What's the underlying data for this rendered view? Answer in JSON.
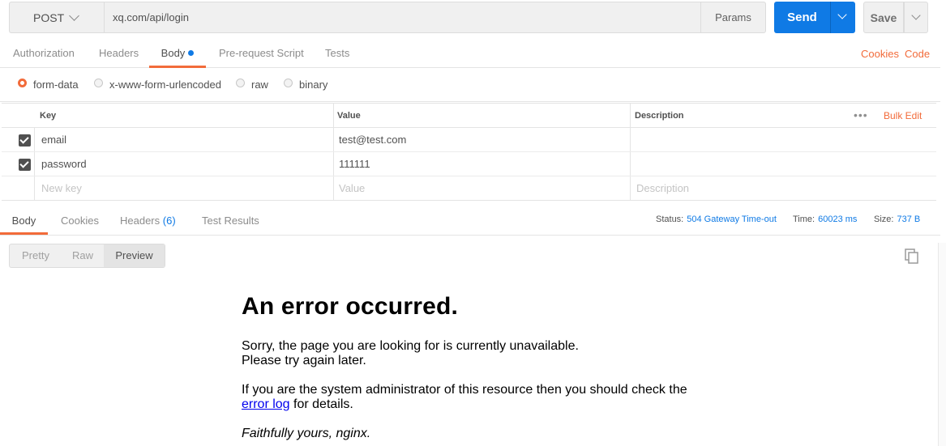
{
  "request": {
    "method": "POST",
    "url": "xq.com/api/login",
    "params_label": "Params",
    "send_label": "Send",
    "save_label": "Save"
  },
  "request_tabs": {
    "authorization": "Authorization",
    "headers": "Headers",
    "body": "Body",
    "pre_request": "Pre-request Script",
    "tests": "Tests",
    "cookies": "Cookies",
    "code": "Code"
  },
  "body_types": {
    "form_data": "form-data",
    "urlencoded": "x-www-form-urlencoded",
    "raw": "raw",
    "binary": "binary",
    "selected": "form-data"
  },
  "table": {
    "headers": {
      "key": "Key",
      "value": "Value",
      "description": "Description"
    },
    "bulk_edit": "Bulk Edit",
    "more": "•••",
    "rows": [
      {
        "key": "email",
        "value": "test@test.com",
        "description": "",
        "checked": true
      },
      {
        "key": "password",
        "value": "111111",
        "description": "",
        "checked": true
      }
    ],
    "placeholders": {
      "key": "New key",
      "value": "Value",
      "description": "Description"
    }
  },
  "response_tabs": {
    "body": "Body",
    "cookies": "Cookies",
    "headers": "Headers",
    "headers_count": "(6)",
    "test_results": "Test Results"
  },
  "status": {
    "status_label": "Status:",
    "status_value": "504 Gateway Time-out",
    "time_label": "Time:",
    "time_value": "60023 ms",
    "size_label": "Size:",
    "size_value": "737 B"
  },
  "viewer": {
    "pretty": "Pretty",
    "raw": "Raw",
    "preview": "Preview"
  },
  "preview": {
    "heading": "An error occurred.",
    "line1": "Sorry, the page you are looking for is currently unavailable.",
    "line2": "Please try again later.",
    "admin_text": "If you are the system administrator of this resource then you should check the",
    "error_log_link": "error log",
    "admin_suffix": " for details.",
    "signature": "Faithfully yours, nginx."
  },
  "colors": {
    "accent": "#f26b3a",
    "primary": "#0f7ae5"
  }
}
